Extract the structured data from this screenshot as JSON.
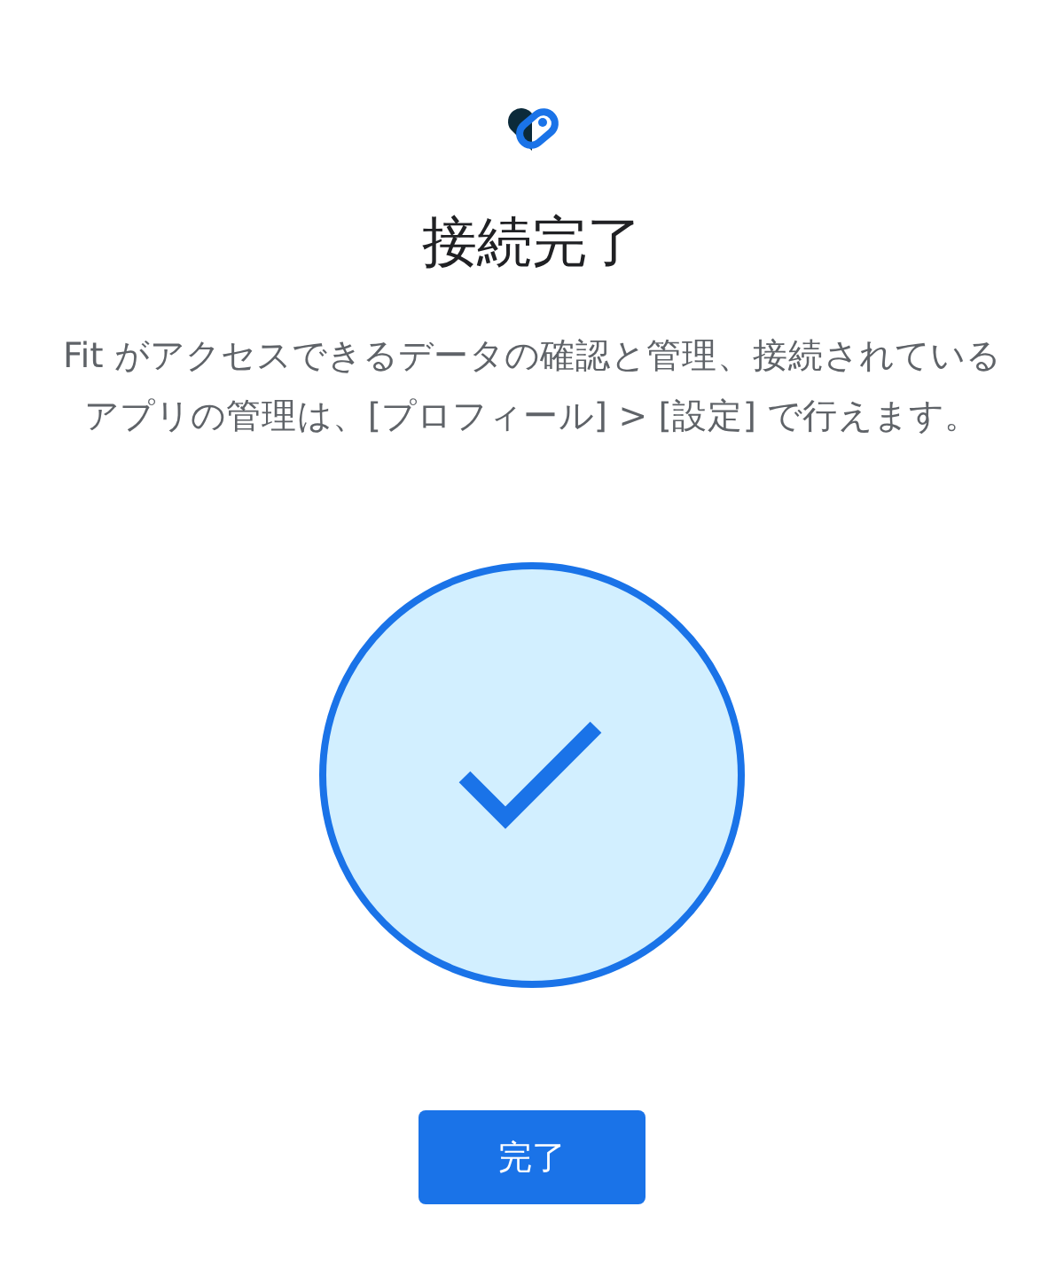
{
  "title": "接続完了",
  "message": "Fit がアクセスできるデータの確認と管理、接続されているアプリの管理は、[プロフィール] > [設定] で行えます。",
  "done_button": {
    "label": "完了"
  }
}
